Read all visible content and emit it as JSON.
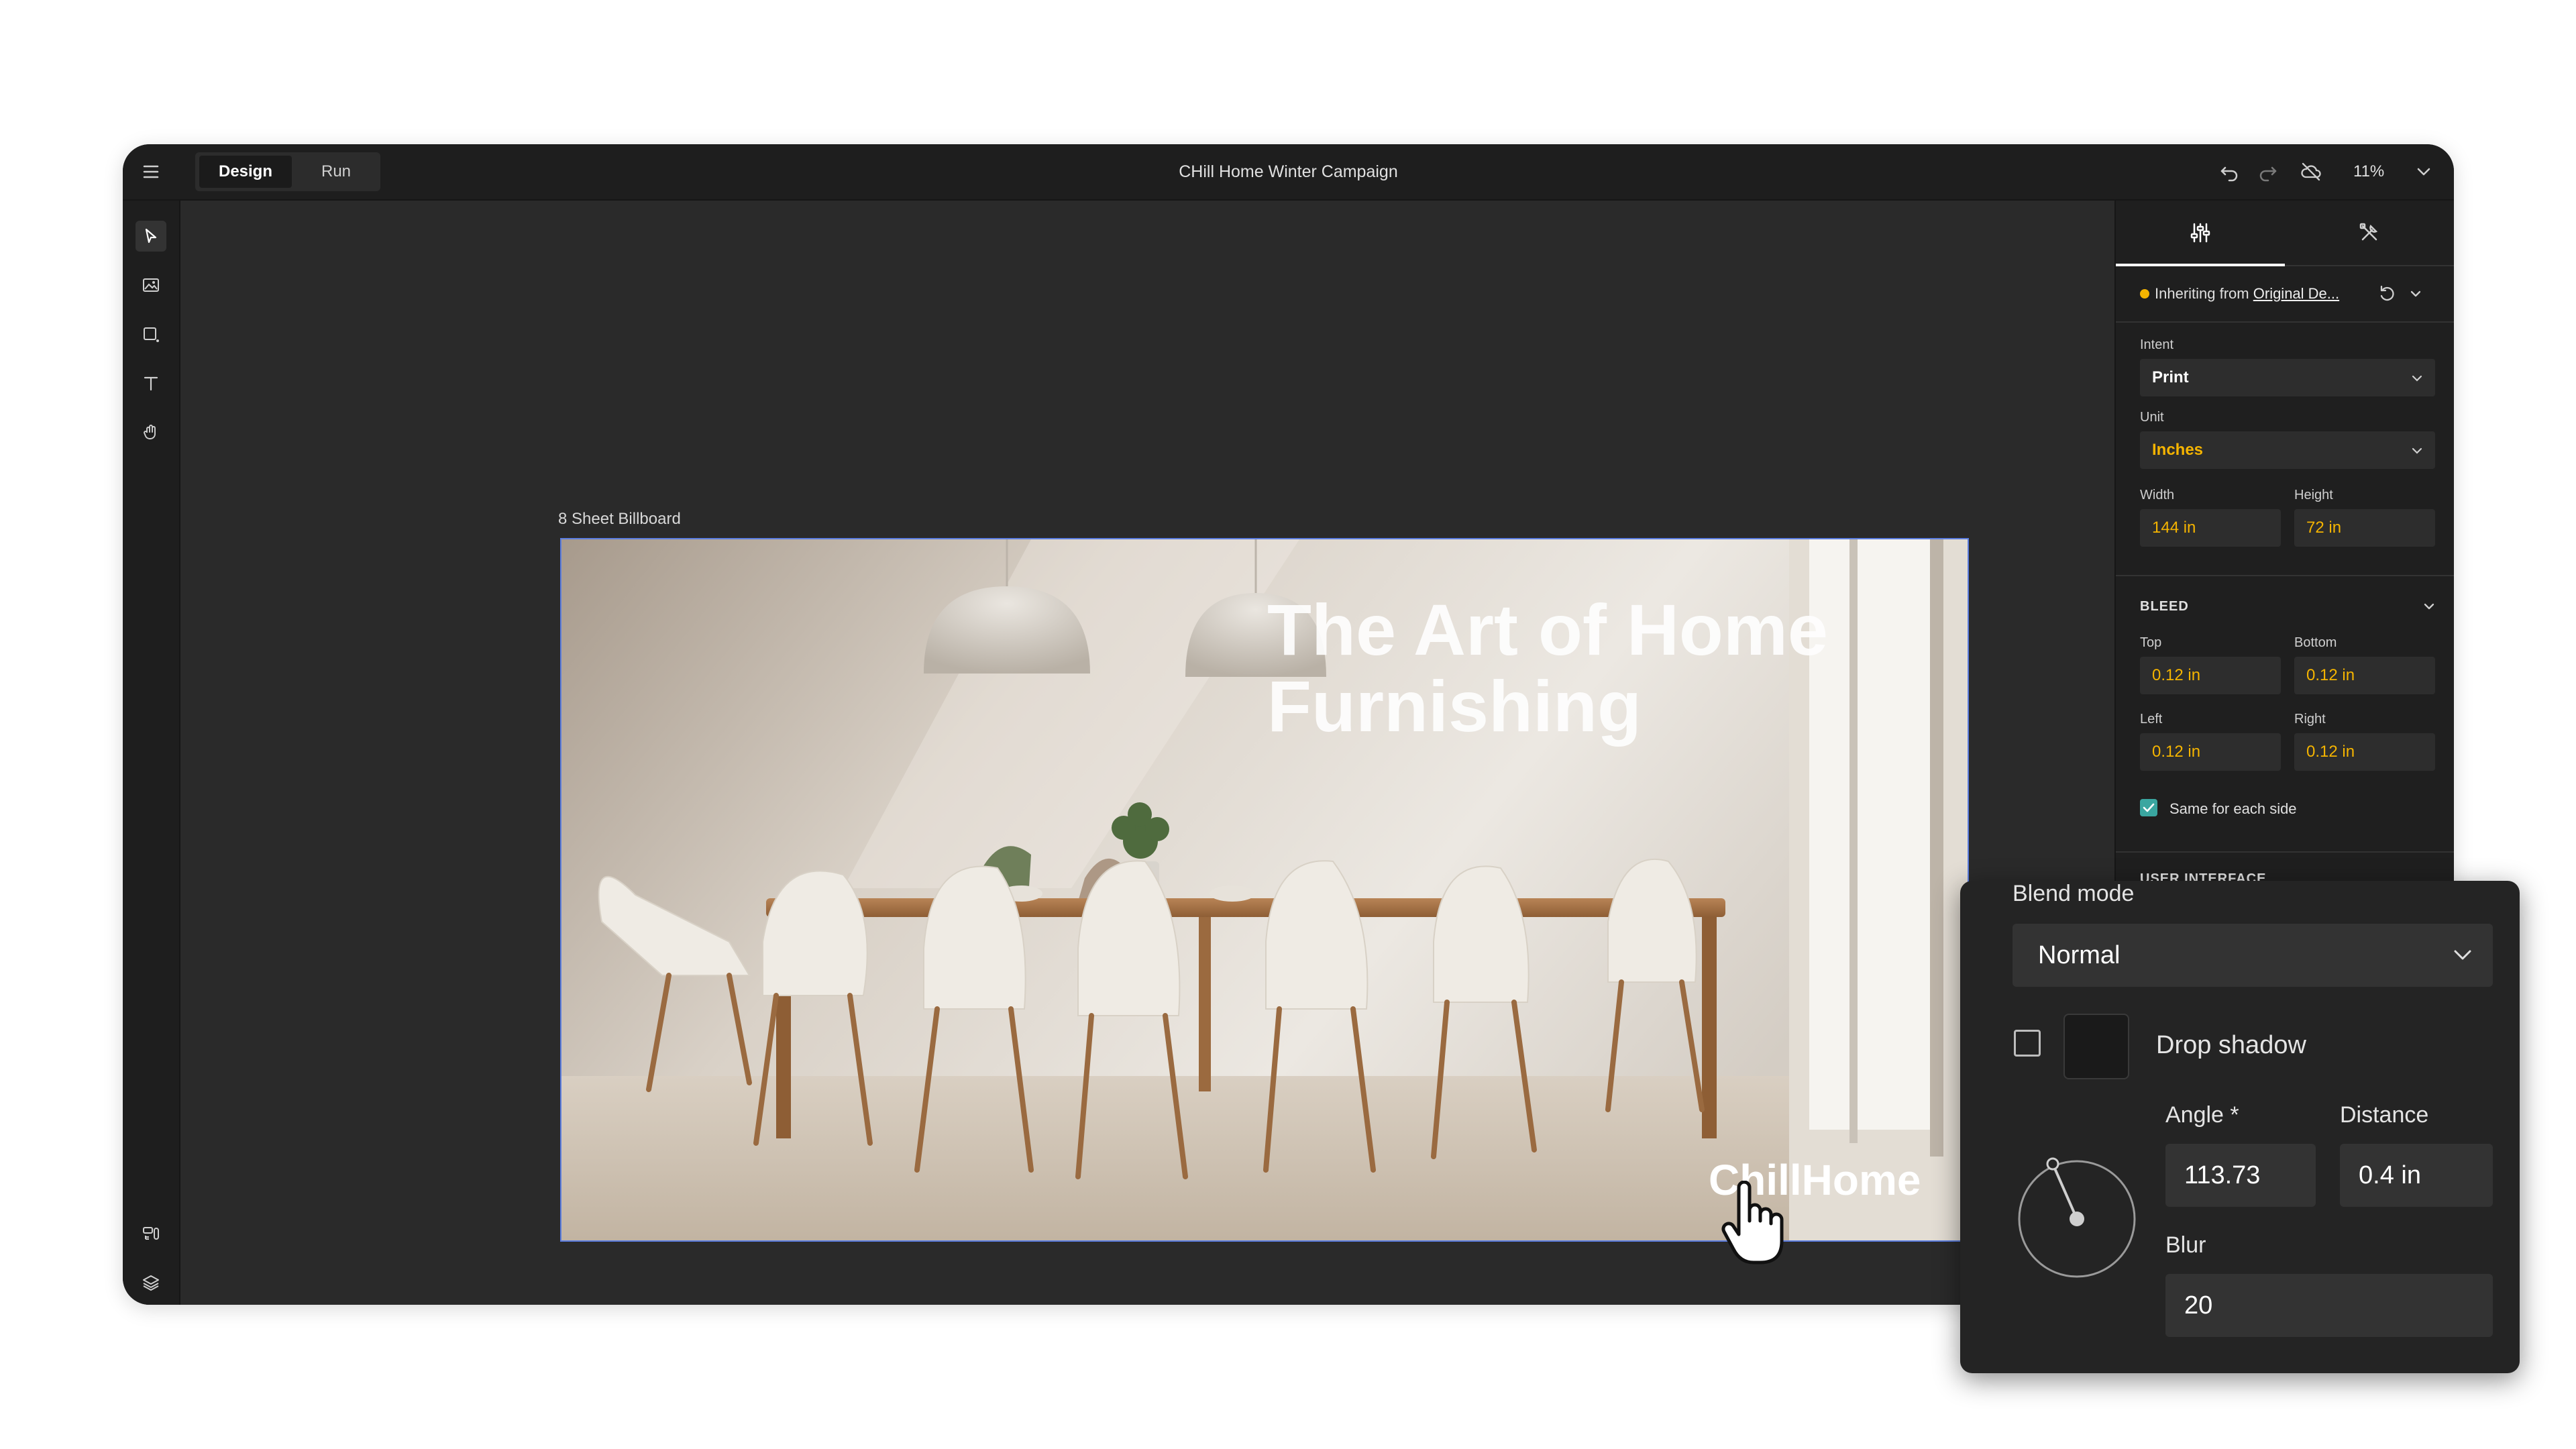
{
  "topbar": {
    "menu_icon": "hamburger-icon",
    "tabs": [
      {
        "label": "Design",
        "active": true
      },
      {
        "label": "Run",
        "active": false
      }
    ],
    "title": "CHill Home Winter Campaign",
    "zoom": "11%",
    "icons": [
      "undo-icon",
      "redo-icon",
      "cloud-off-icon",
      "chevron-down-icon"
    ]
  },
  "toolbar": {
    "tools": [
      "pointer-icon",
      "image-icon",
      "shape-icon",
      "text-icon",
      "hand-icon"
    ],
    "bottom_tools": [
      "variables-icon",
      "layers-icon",
      "components-icon"
    ]
  },
  "canvas": {
    "artboard_label": "8 Sheet Billboard",
    "headline_line1": "The Art of Home",
    "headline_line2": "Furnishing",
    "brand": "ChillHome"
  },
  "inspector": {
    "tabs": [
      "sliders-icon",
      "tools-icon"
    ],
    "inherit_prefix": "Inheriting from",
    "inherit_link": "Original De...",
    "intent_label": "Intent",
    "intent_value": "Print",
    "unit_label": "Unit",
    "unit_value": "Inches",
    "width_label": "Width",
    "width_value": "144 in",
    "height_label": "Height",
    "height_value": "72 in",
    "bleed_title": "BLEED",
    "top_label": "Top",
    "top_value": "0.12 in",
    "bottom_label": "Bottom",
    "bottom_value": "0.12 in",
    "left_label": "Left",
    "left_value": "0.12 in",
    "right_label": "Right",
    "right_value": "0.12 in",
    "same_label": "Same for each side",
    "same_checked": true,
    "next_section": "USER INTERFACE"
  },
  "effects": {
    "blend_label": "Blend mode",
    "blend_value": "Normal",
    "shadow_label": "Drop shadow",
    "shadow_checked": false,
    "shadow_color": "#1a1a1a",
    "angle_label": "Angle *",
    "angle_value": "113.73",
    "distance_label": "Distance",
    "distance_value": "0.4 in",
    "blur_label": "Blur",
    "blur_value": "20"
  },
  "colors": {
    "accent": "#f5b400",
    "selection": "#5b7de0",
    "checkbox": "#3aa6a0"
  }
}
